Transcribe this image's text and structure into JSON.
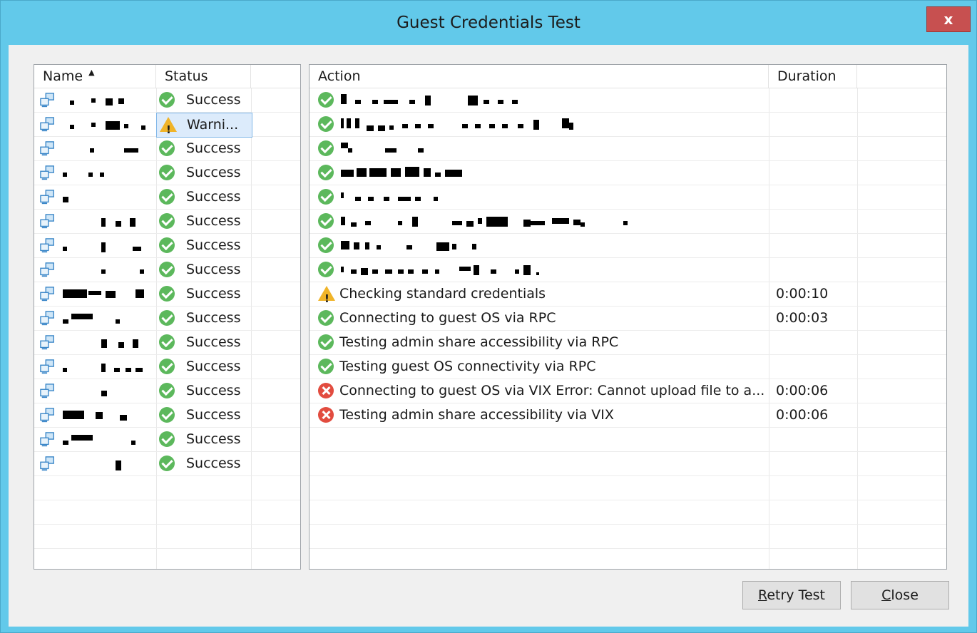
{
  "window": {
    "title": "Guest Credentials Test",
    "close_glyph": "x"
  },
  "vm_list": {
    "columns": {
      "name": "Name",
      "status": "Status"
    },
    "sort_glyph": "▲",
    "rows": [
      {
        "status": "Success",
        "icon": "success-icon"
      },
      {
        "status": "Warni...",
        "icon": "warning-icon",
        "selected": true
      },
      {
        "status": "Success",
        "icon": "success-icon"
      },
      {
        "status": "Success",
        "icon": "success-icon"
      },
      {
        "status": "Success",
        "icon": "success-icon"
      },
      {
        "status": "Success",
        "icon": "success-icon"
      },
      {
        "status": "Success",
        "icon": "success-icon"
      },
      {
        "status": "Success",
        "icon": "success-icon"
      },
      {
        "status": "Success",
        "icon": "success-icon"
      },
      {
        "status": "Success",
        "icon": "success-icon"
      },
      {
        "status": "Success",
        "icon": "success-icon"
      },
      {
        "status": "Success",
        "icon": "success-icon"
      },
      {
        "status": "Success",
        "icon": "success-icon"
      },
      {
        "status": "Success",
        "icon": "success-icon"
      },
      {
        "status": "Success",
        "icon": "success-icon"
      },
      {
        "status": "Success",
        "icon": "success-icon"
      }
    ]
  },
  "actions": {
    "columns": {
      "action": "Action",
      "duration": "Duration"
    },
    "rows": [
      {
        "icon": "success-icon",
        "text": "",
        "duration": ""
      },
      {
        "icon": "success-icon",
        "text": "",
        "duration": ""
      },
      {
        "icon": "success-icon",
        "text": "",
        "duration": ""
      },
      {
        "icon": "success-icon",
        "text": "",
        "duration": ""
      },
      {
        "icon": "success-icon",
        "text": "",
        "duration": ""
      },
      {
        "icon": "success-icon",
        "text": "",
        "duration": ""
      },
      {
        "icon": "success-icon",
        "text": "",
        "duration": ""
      },
      {
        "icon": "success-icon",
        "text": "",
        "duration": ""
      },
      {
        "icon": "warning-icon",
        "text": "Checking standard credentials",
        "duration": "0:00:10"
      },
      {
        "icon": "success-icon",
        "text": "Connecting to guest OS via RPC",
        "duration": "0:00:03"
      },
      {
        "icon": "success-icon",
        "text": "Testing admin share accessibility via RPC",
        "duration": ""
      },
      {
        "icon": "success-icon",
        "text": "Testing guest OS connectivity via RPC",
        "duration": ""
      },
      {
        "icon": "error-icon",
        "text": "Connecting to guest OS via VIX Error: Cannot upload  file to a...",
        "duration": "0:00:06"
      },
      {
        "icon": "error-icon",
        "text": "Testing admin share accessibility via VIX",
        "duration": "0:00:06"
      }
    ]
  },
  "buttons": {
    "retry": {
      "mnemonic": "R",
      "rest": "etry Test"
    },
    "close": {
      "mnemonic": "C",
      "rest": "lose"
    }
  },
  "colors": {
    "title_bar": "#62c9ea",
    "close_button": "#c75050",
    "success": "#5cb85c",
    "warning": "#f0b429",
    "error": "#e24c3f",
    "selection": "#dcebfb"
  }
}
